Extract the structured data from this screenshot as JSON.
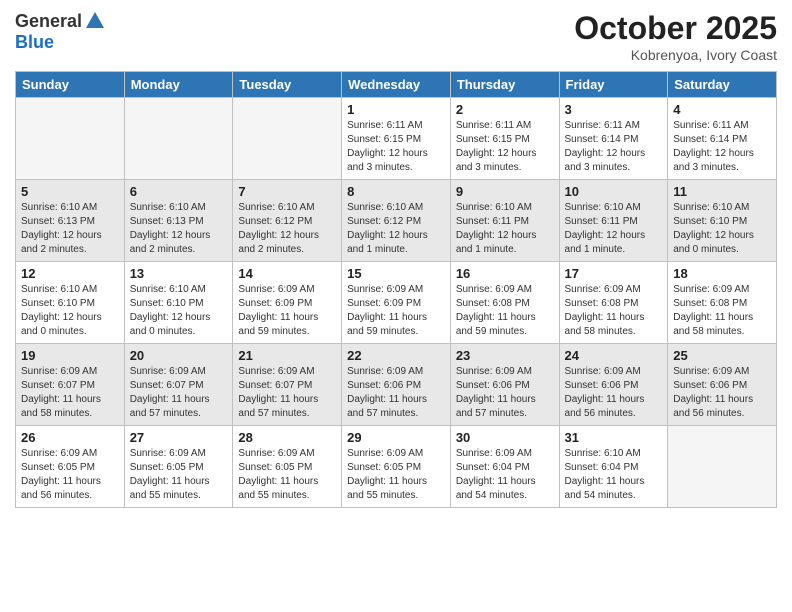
{
  "logo": {
    "general": "General",
    "blue": "Blue"
  },
  "title": {
    "month": "October 2025",
    "location": "Kobrenyoa, Ivory Coast"
  },
  "weekdays": [
    "Sunday",
    "Monday",
    "Tuesday",
    "Wednesday",
    "Thursday",
    "Friday",
    "Saturday"
  ],
  "weeks": [
    [
      {
        "day": "",
        "info": ""
      },
      {
        "day": "",
        "info": ""
      },
      {
        "day": "",
        "info": ""
      },
      {
        "day": "1",
        "info": "Sunrise: 6:11 AM\nSunset: 6:15 PM\nDaylight: 12 hours and 3 minutes."
      },
      {
        "day": "2",
        "info": "Sunrise: 6:11 AM\nSunset: 6:15 PM\nDaylight: 12 hours and 3 minutes."
      },
      {
        "day": "3",
        "info": "Sunrise: 6:11 AM\nSunset: 6:14 PM\nDaylight: 12 hours and 3 minutes."
      },
      {
        "day": "4",
        "info": "Sunrise: 6:11 AM\nSunset: 6:14 PM\nDaylight: 12 hours and 3 minutes."
      }
    ],
    [
      {
        "day": "5",
        "info": "Sunrise: 6:10 AM\nSunset: 6:13 PM\nDaylight: 12 hours and 2 minutes."
      },
      {
        "day": "6",
        "info": "Sunrise: 6:10 AM\nSunset: 6:13 PM\nDaylight: 12 hours and 2 minutes."
      },
      {
        "day": "7",
        "info": "Sunrise: 6:10 AM\nSunset: 6:12 PM\nDaylight: 12 hours and 2 minutes."
      },
      {
        "day": "8",
        "info": "Sunrise: 6:10 AM\nSunset: 6:12 PM\nDaylight: 12 hours and 1 minute."
      },
      {
        "day": "9",
        "info": "Sunrise: 6:10 AM\nSunset: 6:11 PM\nDaylight: 12 hours and 1 minute."
      },
      {
        "day": "10",
        "info": "Sunrise: 6:10 AM\nSunset: 6:11 PM\nDaylight: 12 hours and 1 minute."
      },
      {
        "day": "11",
        "info": "Sunrise: 6:10 AM\nSunset: 6:10 PM\nDaylight: 12 hours and 0 minutes."
      }
    ],
    [
      {
        "day": "12",
        "info": "Sunrise: 6:10 AM\nSunset: 6:10 PM\nDaylight: 12 hours and 0 minutes."
      },
      {
        "day": "13",
        "info": "Sunrise: 6:10 AM\nSunset: 6:10 PM\nDaylight: 12 hours and 0 minutes."
      },
      {
        "day": "14",
        "info": "Sunrise: 6:09 AM\nSunset: 6:09 PM\nDaylight: 11 hours and 59 minutes."
      },
      {
        "day": "15",
        "info": "Sunrise: 6:09 AM\nSunset: 6:09 PM\nDaylight: 11 hours and 59 minutes."
      },
      {
        "day": "16",
        "info": "Sunrise: 6:09 AM\nSunset: 6:08 PM\nDaylight: 11 hours and 59 minutes."
      },
      {
        "day": "17",
        "info": "Sunrise: 6:09 AM\nSunset: 6:08 PM\nDaylight: 11 hours and 58 minutes."
      },
      {
        "day": "18",
        "info": "Sunrise: 6:09 AM\nSunset: 6:08 PM\nDaylight: 11 hours and 58 minutes."
      }
    ],
    [
      {
        "day": "19",
        "info": "Sunrise: 6:09 AM\nSunset: 6:07 PM\nDaylight: 11 hours and 58 minutes."
      },
      {
        "day": "20",
        "info": "Sunrise: 6:09 AM\nSunset: 6:07 PM\nDaylight: 11 hours and 57 minutes."
      },
      {
        "day": "21",
        "info": "Sunrise: 6:09 AM\nSunset: 6:07 PM\nDaylight: 11 hours and 57 minutes."
      },
      {
        "day": "22",
        "info": "Sunrise: 6:09 AM\nSunset: 6:06 PM\nDaylight: 11 hours and 57 minutes."
      },
      {
        "day": "23",
        "info": "Sunrise: 6:09 AM\nSunset: 6:06 PM\nDaylight: 11 hours and 57 minutes."
      },
      {
        "day": "24",
        "info": "Sunrise: 6:09 AM\nSunset: 6:06 PM\nDaylight: 11 hours and 56 minutes."
      },
      {
        "day": "25",
        "info": "Sunrise: 6:09 AM\nSunset: 6:06 PM\nDaylight: 11 hours and 56 minutes."
      }
    ],
    [
      {
        "day": "26",
        "info": "Sunrise: 6:09 AM\nSunset: 6:05 PM\nDaylight: 11 hours and 56 minutes."
      },
      {
        "day": "27",
        "info": "Sunrise: 6:09 AM\nSunset: 6:05 PM\nDaylight: 11 hours and 55 minutes."
      },
      {
        "day": "28",
        "info": "Sunrise: 6:09 AM\nSunset: 6:05 PM\nDaylight: 11 hours and 55 minutes."
      },
      {
        "day": "29",
        "info": "Sunrise: 6:09 AM\nSunset: 6:05 PM\nDaylight: 11 hours and 55 minutes."
      },
      {
        "day": "30",
        "info": "Sunrise: 6:09 AM\nSunset: 6:04 PM\nDaylight: 11 hours and 54 minutes."
      },
      {
        "day": "31",
        "info": "Sunrise: 6:10 AM\nSunset: 6:04 PM\nDaylight: 11 hours and 54 minutes."
      },
      {
        "day": "",
        "info": ""
      }
    ]
  ],
  "shaded_rows": [
    1,
    3
  ]
}
